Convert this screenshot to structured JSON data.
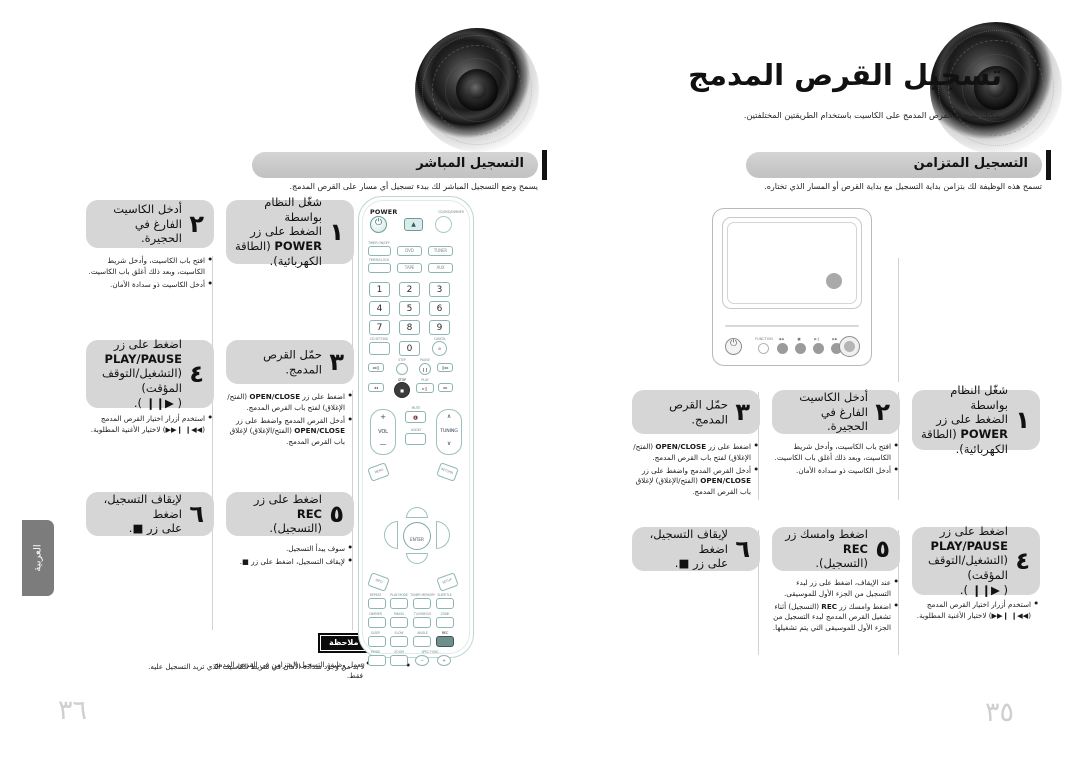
{
  "chapter": {
    "title": "تسجيل القرص المدمج",
    "subtitle": "يمكنك تسجيل القرص المدمج على الكاسيت باستخدام الطريقتين المختلفتين."
  },
  "left_page": {
    "page_number": "٣٦",
    "section": {
      "heading": "التسجيل المباشر",
      "description": "يسمح وضع التسجيل المباشر لك ببدء تسجيل أي مسار على القرص المدمج."
    },
    "steps": [
      {
        "number": "١",
        "text_html": "شغّل النظام بواسطة<br>الضغط على زر<br><b>POWER</b> (الطاقة<br>الكهربائية).",
        "bullets": []
      },
      {
        "number": "٢",
        "text_html": "أدخل الكاسيت الفارغ في<br>الحجيرة.",
        "bullets": [
          "افتح باب الكاسيت، وأدخل شريط الكاسيت، وبعد ذلك أغلق باب الكاسيت.",
          "أدخل الكاسيت ذو سدادة الأمان."
        ]
      },
      {
        "number": "٣",
        "text_html": "حمّل القرص المدمج.",
        "bullets": [
          "اضغط على زر <b>OPEN/CLOSE</b> (الفتح/الإغلاق) لفتح باب القرص المدمج.",
          "أدخل القرص المدمج واضغط على زر <b>OPEN/CLOSE</b> (الفتح/الإغلاق) لإغلاق باب القرص المدمج."
        ]
      },
      {
        "number": "٤",
        "text_html": "اضغط على زر<br><b>PLAY/PAUSE</b><br>(التشغيل/التوقف المؤقت)<br>( <b>&#9654;&#10073;&#10073;</b> ).",
        "bullets": [
          "استخدم أزرار اختيار القرص المدمج (<b>&#9664;&#9664;&#10073; &#10073;&#9654;&#9654;</b>) لاختيار الأغنية المطلوبة."
        ]
      },
      {
        "number": "٥",
        "text_html": "اضغط على زر <b>REC</b><br>(التسجيل).",
        "bullets": [
          "سوف يبدأ التسجيل.",
          "لإيقاف التسجيل، اضغط على زر &#9632;."
        ]
      },
      {
        "number": "٦",
        "text_html": "لإيقاف التسجيل، اضغط<br>على زر &#9632;.",
        "bullets": []
      }
    ],
    "note": {
      "badge": "ملاحظة",
      "items": [
        "لا بد من وجود سدادة الأمان في شريط الكاسيت الذي تريد التسجيل عليه."
      ]
    }
  },
  "right_page": {
    "page_number": "٣٥",
    "section": {
      "heading": "التسجيل المتزامن",
      "description": "تسمح هذه الوظيفة لك بتزامن بداية التسجيل مع بداية القرص أو المسار الذي تختاره."
    },
    "steps": [
      {
        "number": "١",
        "text_html": "شغّل النظام بواسطة<br>الضغط على زر<br><b>POWER</b> (الطاقة<br>الكهربائية).",
        "bullets": []
      },
      {
        "number": "٢",
        "text_html": "أدخل الكاسيت الفارغ في<br>الحجيرة.",
        "bullets": [
          "افتح باب الكاسيت، وأدخل شريط الكاسيت، وبعد ذلك أغلق باب الكاسيت.",
          "أدخل الكاسيت ذو سدادة الأمان."
        ]
      },
      {
        "number": "٣",
        "text_html": "حمّل القرص المدمج.",
        "bullets": [
          "اضغط على زر <b>OPEN/CLOSE</b> (الفتح/الإغلاق) لفتح باب القرص المدمج.",
          "أدخل القرص المدمج واضغط على زر <b>OPEN/CLOSE</b> (الفتح/الإغلاق) لإغلاق باب القرص المدمج."
        ]
      },
      {
        "number": "٤",
        "text_html": "اضغط على زر<br><b>PLAY/PAUSE</b><br>(التشغيل/التوقف المؤقت)<br>( <b>&#9654;&#10073;&#10073;</b> ).",
        "bullets": [
          "استخدم أزرار اختيار القرص المدمج (<b>&#9664;&#9664;&#10073; &#10073;&#9654;&#9654;</b>) لاختيار الأغنية المطلوبة."
        ]
      },
      {
        "number": "٥",
        "text_html": "اضغط وامسك زر <b>REC</b><br>(التسجيل).",
        "bullets": [
          "عند الإيقاف، اضغط على زر لبدء التسجيل من الجزء الأول للموسيقى.",
          "اضغط وامسك زر <b>REC</b> (التسجيل) أثناء تشغيل القرص المدمج لبدء التسجيل من الجزء الأول للموسيقى التي يتم تشغيلها."
        ]
      },
      {
        "number": "٦",
        "text_html": "لإيقاف التسجيل، اضغط<br>على زر &#9632;.",
        "bullets": []
      }
    ],
    "note": {
      "badge": "ملاحظة",
      "items": [
        "تعمل وظيفة التسجيل المتزامن في القرص المدمج فقط."
      ]
    }
  },
  "language_tab": {
    "label": "العربية"
  },
  "remote": {
    "name": "remote-control",
    "power_label": "POWER",
    "dimmer_label": "CD/DVD/DIMMER",
    "source_labels": [
      "TIMER ON/OFF",
      "DVD",
      "TUNER",
      "TIMER/CLOCK",
      "TAPE",
      "AUX"
    ],
    "numbers": [
      "1",
      "2",
      "3",
      "4",
      "5",
      "6",
      "7",
      "8",
      "9",
      "0"
    ],
    "cd_setting_label": "CD SETTING",
    "cancel_label": "CANCEL",
    "transport_labels": [
      "STEP",
      "PAUSE",
      "STOP",
      "PLAY"
    ],
    "vol_label": "VOL",
    "tuning_label": "TUNING",
    "mute_label": "MUTE",
    "audio_label": "AUDIO",
    "menu_label": "MENU",
    "return_label": "RETURN",
    "enter_label": "ENTER",
    "info_label": "INFO",
    "setup_label": "SETUP",
    "row_labels_1": [
      "REPEAT",
      "PLAY MODE",
      "TUNER MEMORY",
      "SUBTITLE"
    ],
    "row_labels_2": [
      "DIMMER",
      "P.BASS",
      "TV/VIDEO/S",
      "ZONE"
    ],
    "row_labels_3": [
      "SLEEP",
      "SLOW",
      "ANGLE",
      "REC"
    ],
    "row_labels_4": [
      "MODE",
      "ZOOM",
      "SPEC FUNC -",
      "+"
    ]
  },
  "front_panel": {
    "name": "main-unit-front-panel",
    "function_label": "FUNCTION",
    "button_labels": [
      "◀◀",
      "■",
      "▶▐▐",
      "▶▶"
    ]
  },
  "colors": {
    "step_box_bg": "#d6d6d6",
    "section_header_bg": "#c9c9c9",
    "note_badge_bg": "#0b0b0b",
    "lang_tab_bg": "#7c7c7c",
    "page_number": "#cfcfcf",
    "remote_outline": "#bcd6d4"
  }
}
